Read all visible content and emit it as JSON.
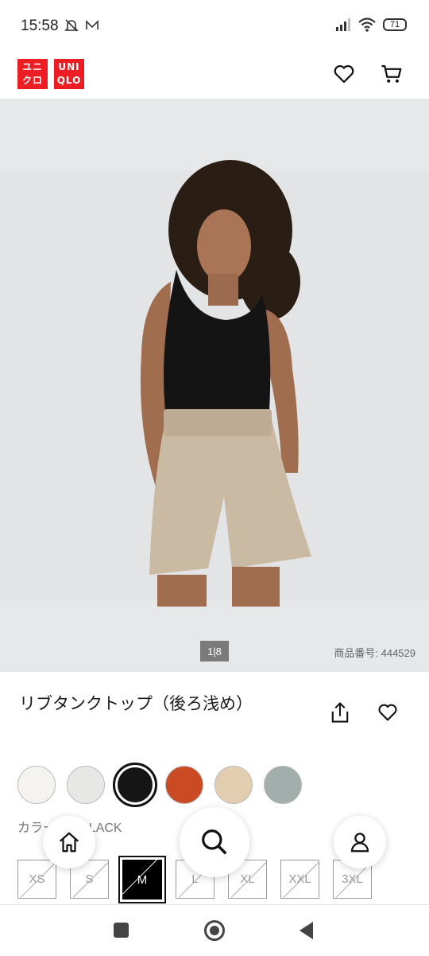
{
  "status_bar": {
    "time": "15:58",
    "battery": "71"
  },
  "header": {
    "logo_left": "ユニ\nクロ",
    "logo_right": "UNI\nQLO"
  },
  "hero": {
    "counter": "1|8",
    "product_code": "商品番号: 444529"
  },
  "product": {
    "title": "リブタンクトップ（後ろ浅め）"
  },
  "colors": {
    "label": "カラー: 09 BLACK",
    "swatches": [
      {
        "name": "white",
        "hex": "#f4f3ef"
      },
      {
        "name": "light-gray",
        "hex": "#e7e7e6"
      },
      {
        "name": "black",
        "hex": "#151515",
        "selected": true
      },
      {
        "name": "orange",
        "hex": "#c94a23"
      },
      {
        "name": "beige",
        "hex": "#e2cdb0"
      },
      {
        "name": "sage",
        "hex": "#a2aeab"
      }
    ]
  },
  "sizes": [
    "XS",
    "S",
    "M",
    "L",
    "XL",
    "XXL",
    "3XL"
  ],
  "selected_size": "M",
  "accent_color": "#ed1d24"
}
